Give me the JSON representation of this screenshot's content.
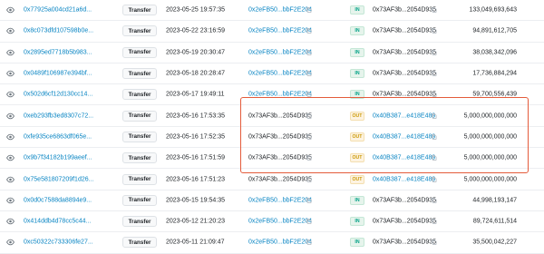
{
  "method_label": "Transfer",
  "rows": [
    {
      "hash": "0x77925a004cd21a6d...",
      "date": "2023-05-25 19:57:35",
      "from": "0x2eFB50...bbF2E204",
      "from_link": true,
      "dir": "IN",
      "to": "0x73AF3b...2054D935",
      "to_link": false,
      "qty": "133,049,693,643"
    },
    {
      "hash": "0x8c073dfd107598b0e...",
      "date": "2023-05-22 23:16:59",
      "from": "0x2eFB50...bbF2E204",
      "from_link": true,
      "dir": "IN",
      "to": "0x73AF3b...2054D935",
      "to_link": false,
      "qty": "94,891,612,705"
    },
    {
      "hash": "0x2895ed7718b5b983...",
      "date": "2023-05-19 20:30:47",
      "from": "0x2eFB50...bbF2E204",
      "from_link": true,
      "dir": "IN",
      "to": "0x73AF3b...2054D935",
      "to_link": false,
      "qty": "38,038,342,096"
    },
    {
      "hash": "0x0489f106987e394bf...",
      "date": "2023-05-18 20:28:47",
      "from": "0x2eFB50...bbF2E204",
      "from_link": true,
      "dir": "IN",
      "to": "0x73AF3b...2054D935",
      "to_link": false,
      "qty": "17,736,884,294"
    },
    {
      "hash": "0x502d6cf12d130cc14...",
      "date": "2023-05-17 19:49:11",
      "from": "0x2eFB50...bbF2E204",
      "from_link": true,
      "dir": "IN",
      "to": "0x73AF3b...2054D935",
      "to_link": false,
      "qty": "59,700,556,439"
    },
    {
      "hash": "0xeb293fb3ed8307c72...",
      "date": "2023-05-16 17:53:35",
      "from": "0x73AF3b...2054D935",
      "from_link": false,
      "dir": "OUT",
      "to": "0x40B387...e418E489",
      "to_link": true,
      "qty": "5,000,000,000,000"
    },
    {
      "hash": "0xfe935ce6863df065e...",
      "date": "2023-05-16 17:52:35",
      "from": "0x73AF3b...2054D935",
      "from_link": false,
      "dir": "OUT",
      "to": "0x40B387...e418E489",
      "to_link": true,
      "qty": "5,000,000,000,000"
    },
    {
      "hash": "0x9b7f34182b199aeef...",
      "date": "2023-05-16 17:51:59",
      "from": "0x73AF3b...2054D935",
      "from_link": false,
      "dir": "OUT",
      "to": "0x40B387...e418E489",
      "to_link": true,
      "qty": "5,000,000,000,000"
    },
    {
      "hash": "0x75e581807209f1d26...",
      "date": "2023-05-16 17:51:23",
      "from": "0x73AF3b...2054D935",
      "from_link": false,
      "dir": "OUT",
      "to": "0x40B387...e418E489",
      "to_link": true,
      "qty": "5,000,000,000,000"
    },
    {
      "hash": "0x0d0c7588da8894e9...",
      "date": "2023-05-15 19:54:35",
      "from": "0x2eFB50...bbF2E204",
      "from_link": true,
      "dir": "IN",
      "to": "0x73AF3b...2054D935",
      "to_link": false,
      "qty": "44,998,193,147"
    },
    {
      "hash": "0x414ddb4d78cc5c44...",
      "date": "2023-05-12 21:20:23",
      "from": "0x2eFB50...bbF2E204",
      "from_link": true,
      "dir": "IN",
      "to": "0x73AF3b...2054D935",
      "to_link": false,
      "qty": "89,724,611,514"
    },
    {
      "hash": "0xc50322c733306fe27...",
      "date": "2023-05-11 21:09:47",
      "from": "0x2eFB50...bbF2E204",
      "from_link": true,
      "dir": "IN",
      "to": "0x73AF3b...2054D935",
      "to_link": false,
      "qty": "35,500,042,227"
    }
  ],
  "colors": {
    "link": "#0784c3",
    "in_badge": "#00a186",
    "out_badge": "#cc9a06",
    "highlight": "#e45b3b"
  }
}
